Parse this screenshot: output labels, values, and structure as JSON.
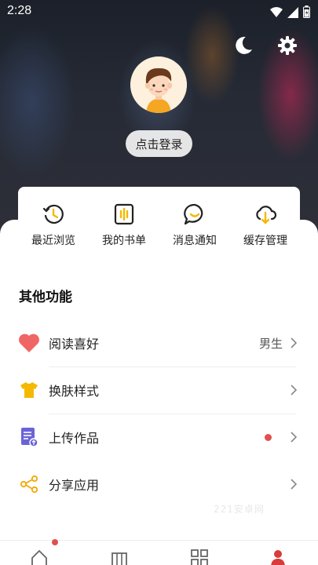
{
  "status_bar": {
    "time": "2:28",
    "icons": [
      "wifi-icon",
      "signal-icon",
      "battery-icon"
    ]
  },
  "header": {
    "night_mode_icon": "moon-icon",
    "settings_icon": "gear-icon"
  },
  "profile": {
    "login_label": "点击登录"
  },
  "quick_actions": [
    {
      "label": "最近浏览",
      "icon": "history-clock-icon"
    },
    {
      "label": "我的书单",
      "icon": "booklist-icon"
    },
    {
      "label": "消息通知",
      "icon": "message-bubble-icon"
    },
    {
      "label": "缓存管理",
      "icon": "cloud-download-icon"
    }
  ],
  "other_functions": {
    "title": "其他功能",
    "items": [
      {
        "label": "阅读喜好",
        "value": "男生",
        "icon": "heart-icon"
      },
      {
        "label": "换肤样式",
        "icon": "tshirt-icon"
      },
      {
        "label": "上传作品",
        "icon": "upload-document-icon",
        "has_dot": true
      },
      {
        "label": "分享应用",
        "icon": "share-icon"
      }
    ]
  },
  "watermark": "221安卓网",
  "tab_bar": {
    "icons": [
      "home-icon",
      "library-icon",
      "category-icon",
      "profile-icon"
    ],
    "active": "profile-icon"
  },
  "colors": {
    "accent_red": "#e05050",
    "heart": "#f06666",
    "tshirt": "#f5b800",
    "upload": "#6a64d8",
    "share": "#f2a900"
  }
}
